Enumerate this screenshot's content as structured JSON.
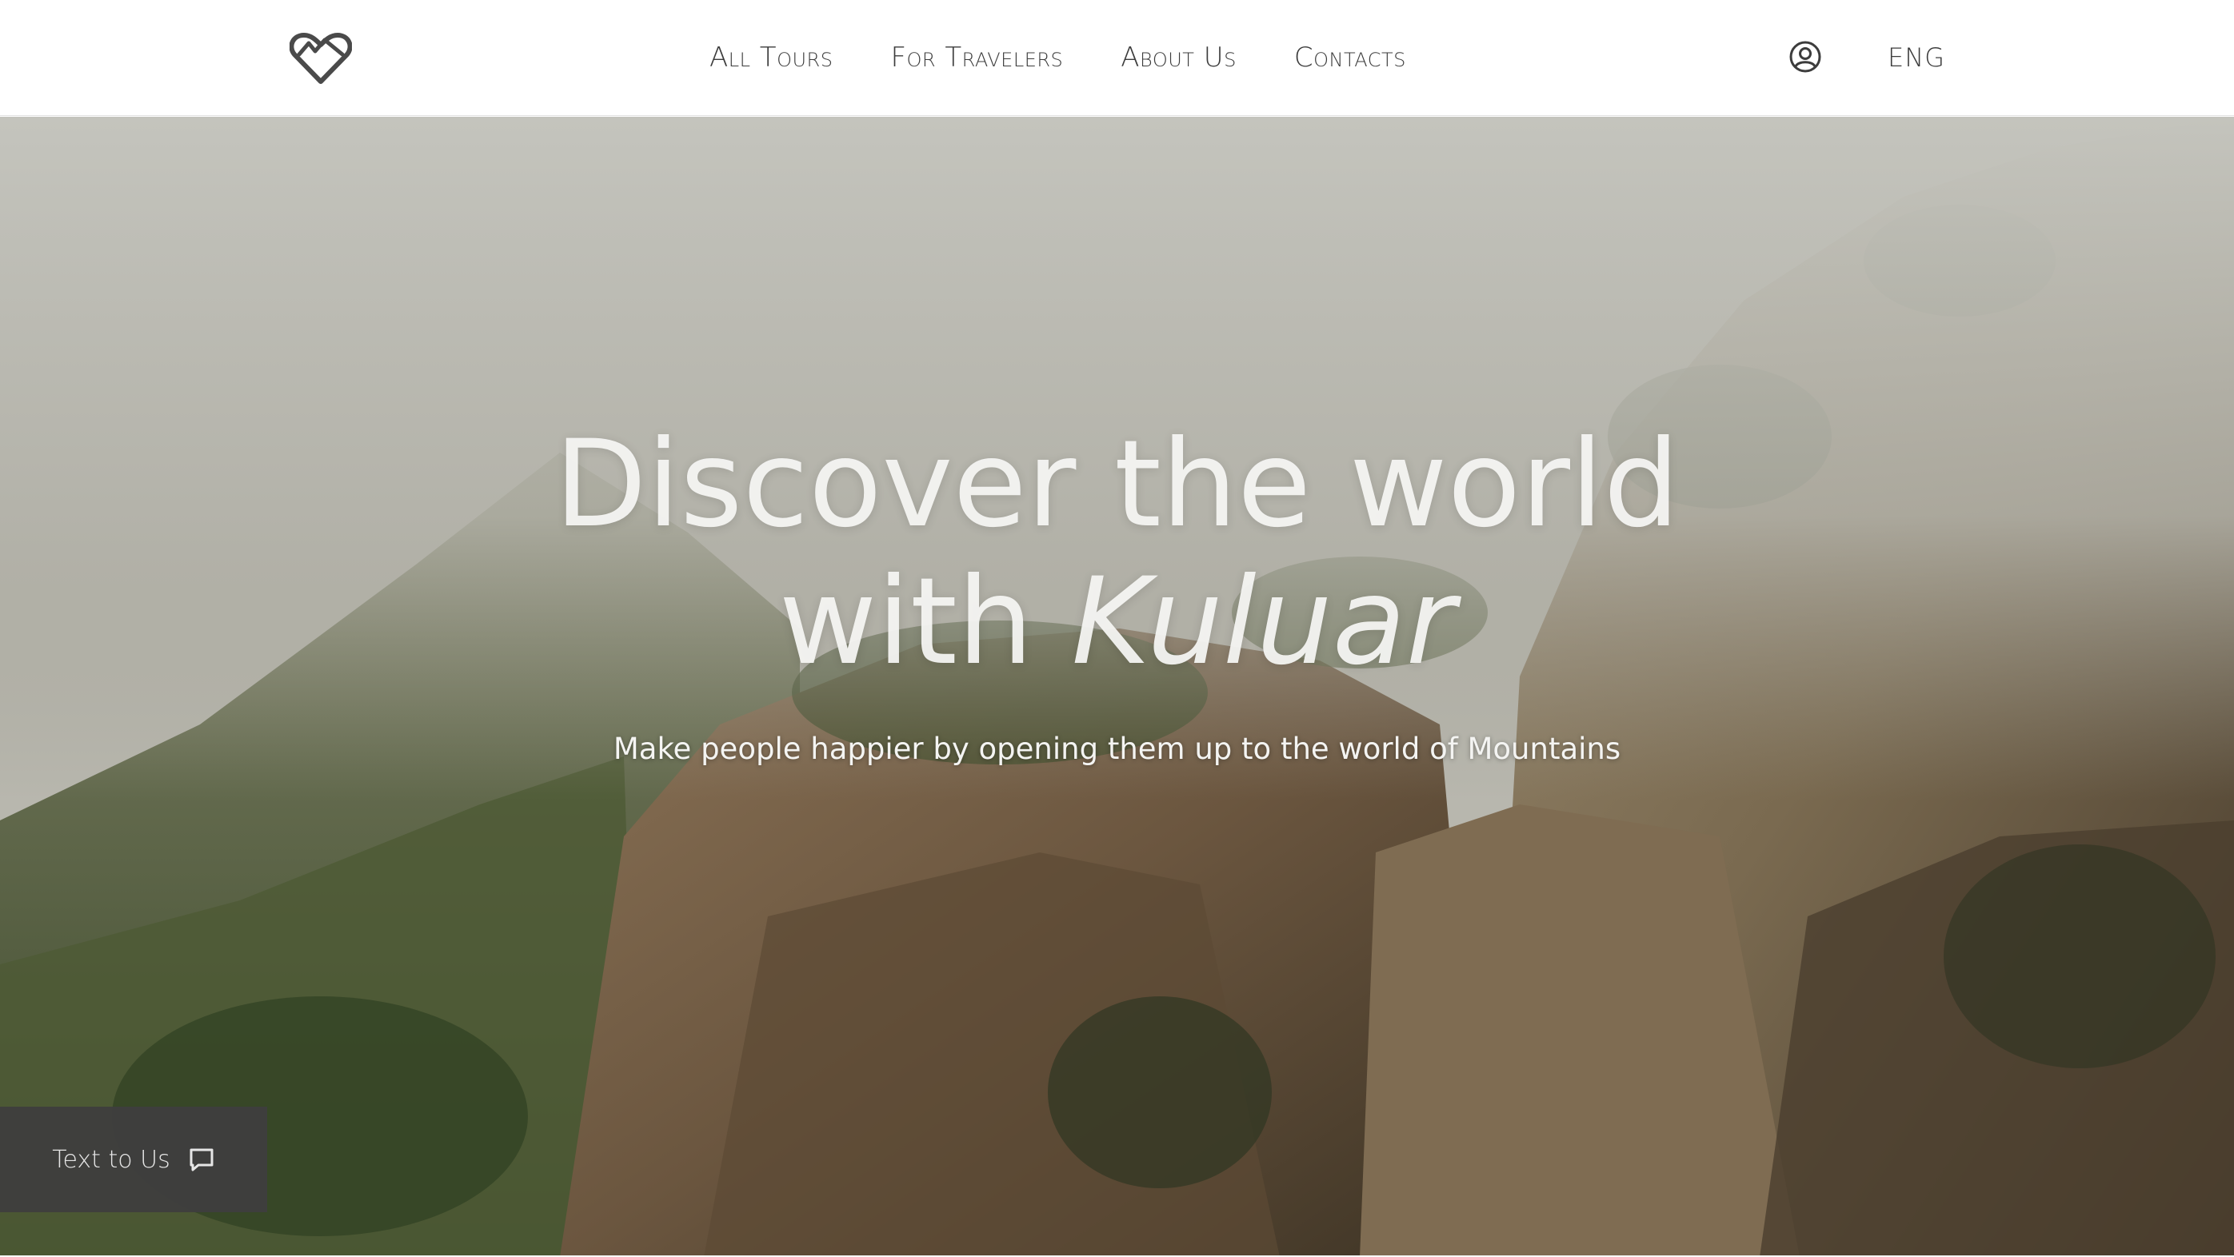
{
  "header": {
    "logo_icon": "mountain-heart-logo-icon",
    "nav": [
      {
        "label": "All Tours"
      },
      {
        "label": "For Travelers"
      },
      {
        "label": "About Us"
      },
      {
        "label": "Contacts"
      }
    ],
    "user_icon": "user-circle-icon",
    "language": "ENG"
  },
  "hero": {
    "title_line1": "Discover the world",
    "title_line2_prefix": "with ",
    "title_brand": "Kuluar",
    "subtitle": "Make people happier by opening them up to the world of Mountains",
    "background": "foggy-mountain-cliffs-image"
  },
  "chat": {
    "label": "Text to Us",
    "icon": "message-bubble-icon"
  },
  "colors": {
    "header_bg": "#ffffff",
    "nav_text": "#3c3c3c",
    "hero_text": "#f5f5f3",
    "chat_bg": "#3e3e3e"
  }
}
